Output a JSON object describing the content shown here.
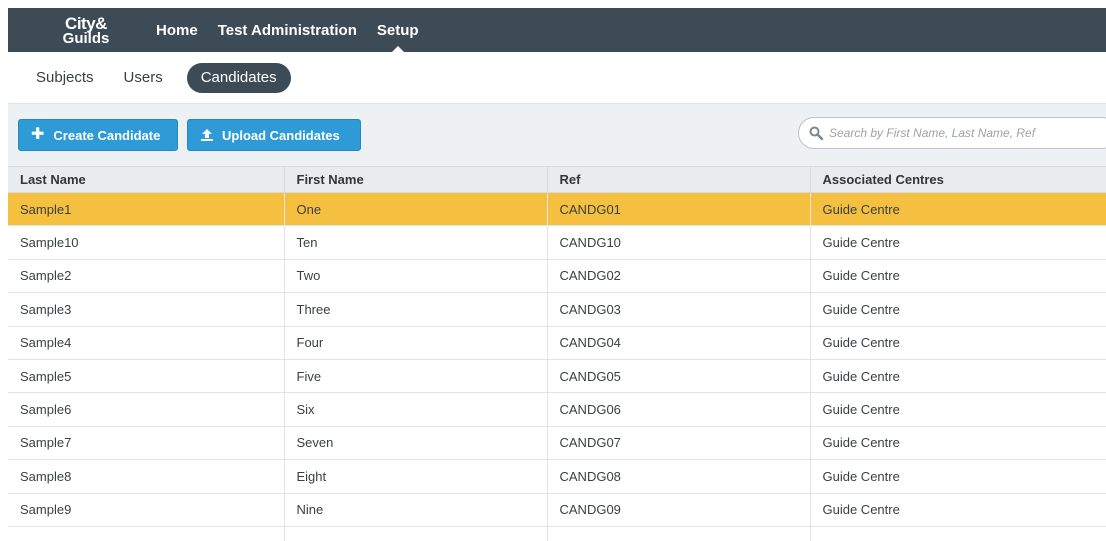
{
  "logo": {
    "line1": "City&",
    "line2": "Guilds"
  },
  "topnav": [
    {
      "label": "Home",
      "active": false
    },
    {
      "label": "Test Administration",
      "active": false
    },
    {
      "label": "Setup",
      "active": true
    }
  ],
  "subnav": [
    {
      "label": "Subjects",
      "active": false
    },
    {
      "label": "Users",
      "active": false
    },
    {
      "label": "Candidates",
      "active": true
    }
  ],
  "toolbar": {
    "create_label": "Create Candidate",
    "create_icon": "plus-icon",
    "upload_label": "Upload Candidates",
    "upload_icon": "upload-icon",
    "search_placeholder": "Search by First Name, Last Name, Ref",
    "search_value": ""
  },
  "colors": {
    "nav_bg": "#3d4b56",
    "button_bg": "#2e9ad6",
    "selected_row": "#f5bf3f"
  },
  "table": {
    "columns": [
      "Last Name",
      "First Name",
      "Ref",
      "Associated Centres"
    ],
    "selected_index": 0,
    "rows": [
      [
        "Sample1",
        "One",
        "CANDG01",
        "Guide Centre"
      ],
      [
        "Sample10",
        "Ten",
        "CANDG10",
        "Guide Centre"
      ],
      [
        "Sample2",
        "Two",
        "CANDG02",
        "Guide Centre"
      ],
      [
        "Sample3",
        "Three",
        "CANDG03",
        "Guide Centre"
      ],
      [
        "Sample4",
        "Four",
        "CANDG04",
        "Guide Centre"
      ],
      [
        "Sample5",
        "Five",
        "CANDG05",
        "Guide Centre"
      ],
      [
        "Sample6",
        "Six",
        "CANDG06",
        "Guide Centre"
      ],
      [
        "Sample7",
        "Seven",
        "CANDG07",
        "Guide Centre"
      ],
      [
        "Sample8",
        "Eight",
        "CANDG08",
        "Guide Centre"
      ],
      [
        "Sample9",
        "Nine",
        "CANDG09",
        "Guide Centre"
      ],
      [
        "",
        "",
        "",
        ""
      ]
    ]
  }
}
